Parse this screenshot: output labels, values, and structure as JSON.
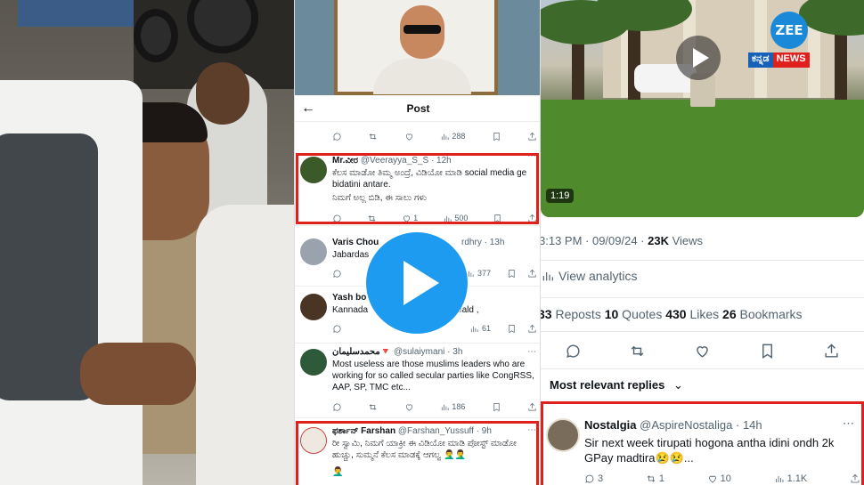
{
  "middle": {
    "header": {
      "title": "Post",
      "back_icon": "←"
    },
    "top_actions": {
      "views": "288"
    },
    "tweets": [
      {
        "name": "Mr.ವೀರ",
        "handle": "@Veerayya_S_S",
        "time": "· 12h",
        "text_line1": "ಕೆಲಸ ಮಾಡೋ ತಿಮ್ಮ ಅಂದ್ರೆ, ವಿಡಿಯೋ ಮಾಡಿ social media ge bidatini antare.",
        "text_line2": "ನಿಮಗೆ ಅಲ್ಲ ಬಿಡಿ, ಈ ಸಾಲು ಗಳು",
        "likes": "1",
        "views": "500"
      },
      {
        "name": "Varis Chou",
        "handle": "rdhry",
        "time": "· 13h",
        "text_line1": "Jabardas",
        "text_line2": "",
        "likes": "",
        "views": "377"
      },
      {
        "name": "Yash bo",
        "handle": "",
        "time": "",
        "text_line1": "Kannada",
        "text_line2": "bald ,",
        "likes": "",
        "views": "61"
      },
      {
        "name": "محمدسلیمان🔻",
        "handle": "@sulaiymani",
        "time": "· 3h",
        "text_line1": "Most useless are those muslims leaders who are working for so called secular parties like CongRSS, AAP, SP, TMC etc...",
        "text_line2": "",
        "likes": "",
        "views": "186"
      },
      {
        "name": "ಫರ್ಶಾನ್ Farshan",
        "handle": "@Farshan_Yussuff",
        "time": "· 9h",
        "text_line1": "ರೀ ಸ್ವಾಮಿ, ನಿಮಗೆ ಯಾಕ್ರೀ ಈ ವಿಡಿಯೋ ಮಾಡಿ ಪೋಸ್ಟ್ ಮಾಡೋ ಹುಚ್ಚು, ಸುಮ್ಮನೆ ಕೆಲಸ ಮಾಡಕ್ಕೆ ಆಗಲ್ವ 🤦‍♂️🤦‍♂️",
        "text_line2": "🤦‍♂️"
      }
    ]
  },
  "right": {
    "video": {
      "duration": "1:19",
      "brand_top": "ZEE",
      "brand_left": "ಕನ್ನಡ",
      "brand_right": "NEWS"
    },
    "meta": {
      "time_date": "3:13 PM · 09/09/24 · ",
      "views_count": "23K",
      "views_label": " Views"
    },
    "analytics_label": "View analytics",
    "stats": {
      "reposts_count": "33",
      "reposts_label": " Reposts ",
      "quotes_count": "10",
      "quotes_label": " Quotes ",
      "likes_count": "430",
      "likes_label": " Likes ",
      "bookmarks_count": "26",
      "bookmarks_label": " Bookmarks"
    },
    "relevant_label": "Most relevant replies",
    "reply": {
      "name": "Nostalgia",
      "handle": "@AspireNostaliga",
      "time": " · 14h",
      "text": "Sir next week tirupati hogona antha idini ondh 2k GPay madtira😢😢...",
      "replies": "3",
      "reposts": "1",
      "likes": "10",
      "views": "1.1K"
    }
  },
  "colors": {
    "accent_blue": "#1d9bf0",
    "highlight_red": "#e0201d"
  }
}
